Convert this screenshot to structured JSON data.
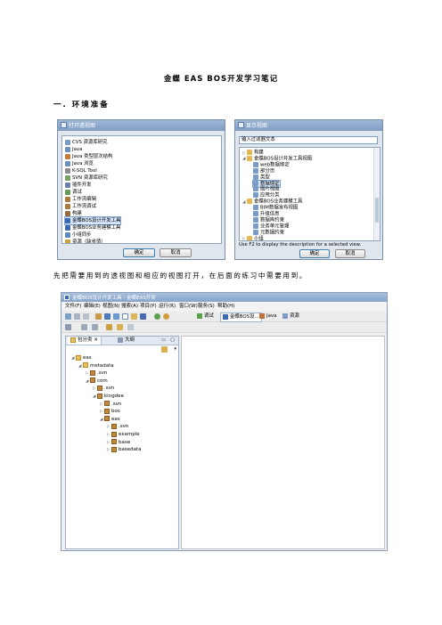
{
  "doc": {
    "title": "金蝶 EAS BOS开发学习笔记",
    "section": "一.  环境准备",
    "paragraph": "先把需要用到的透视图和相应的视图打开，在后面的练习中需要用到。"
  },
  "dialog_left": {
    "title": "打开透视图",
    "items": [
      {
        "label": "CVS 资源库研究",
        "color": "#7a9cc6"
      },
      {
        "label": "Java",
        "color": "#6d8fc0"
      },
      {
        "label": "Java 类型层次结构",
        "color": "#c77a3a"
      },
      {
        "label": "Java 浏览",
        "color": "#6d8fc0"
      },
      {
        "label": "K-SQL Tool",
        "color": "#8a8a8a"
      },
      {
        "label": "SVN 资源库研究",
        "color": "#7aa06a"
      },
      {
        "label": "插件开发",
        "color": "#6a7fb0"
      },
      {
        "label": "调试",
        "color": "#6a9a5a"
      },
      {
        "label": "工作流编辑",
        "color": "#b07a3a"
      },
      {
        "label": "工作流调试",
        "color": "#b07a3a"
      },
      {
        "label": "构建",
        "color": "#9a6a3a"
      },
      {
        "label": "金蝶BOS设计开发工具",
        "color": "#3a6ab0",
        "selected": true
      },
      {
        "label": "金蝶BOS业务建模工具",
        "color": "#3a6ab0"
      },
      {
        "label": "小组同步",
        "color": "#5a8aba"
      },
      {
        "label": "资源（缺省值）",
        "color": "#d0a040"
      }
    ],
    "ok": "确定",
    "cancel": "取消"
  },
  "dialog_right": {
    "title": "显示视图",
    "filter_placeholder": "输入过滤器文本",
    "tree": [
      {
        "label": "构建",
        "level": 0,
        "kind": "folder",
        "twisty": "▷"
      },
      {
        "label": "金蝶BOS设计开发工具视图",
        "level": 0,
        "kind": "folder",
        "twisty": "◢"
      },
      {
        "label": "web数据绑定",
        "level": 1,
        "kind": "view"
      },
      {
        "label": "部分页",
        "level": 1,
        "kind": "view"
      },
      {
        "label": "类型",
        "level": 1,
        "kind": "view"
      },
      {
        "label": "数据绑定",
        "level": 1,
        "kind": "view",
        "selected": true
      },
      {
        "label": "图片视图",
        "level": 1,
        "kind": "view"
      },
      {
        "label": "应用分类",
        "level": 1,
        "kind": "view"
      },
      {
        "label": "金蝶BOS业务建模工具",
        "level": 0,
        "kind": "folder",
        "twisty": "◢"
      },
      {
        "label": "BIM数据发布视图",
        "level": 1,
        "kind": "view"
      },
      {
        "label": "升级信息",
        "level": 1,
        "kind": "view"
      },
      {
        "label": "数据库约束",
        "level": 1,
        "kind": "view"
      },
      {
        "label": "业务单元管理",
        "level": 1,
        "kind": "view"
      },
      {
        "label": "元数据约束",
        "level": 1,
        "kind": "view"
      },
      {
        "label": "小组",
        "level": 0,
        "kind": "folder",
        "twisty": "▷"
      }
    ],
    "hint": "Use F2 to display the description for a selected view.",
    "ok": "确定",
    "cancel": "取消"
  },
  "ide": {
    "title": "金蝶BOS设计开发工具 - 金蝶EAS开发",
    "menu": [
      "文件(F)",
      "编辑(E)",
      "视图(N)",
      "搜索(A)",
      "项目(P)",
      "运行(R)",
      "窗口(W)",
      "服务(S)",
      "帮助(H)"
    ],
    "perspectives": [
      "调试",
      "金蝶BOS设...",
      "Java",
      "资源"
    ],
    "tabs": [
      "包分类",
      "大纲"
    ],
    "tree": [
      {
        "label": "eas",
        "level": 0,
        "kind": "project",
        "twisty": "◢"
      },
      {
        "label": "metadata",
        "level": 1,
        "kind": "folder",
        "twisty": "◢"
      },
      {
        "label": ".svn",
        "level": 2,
        "kind": "pkg",
        "twisty": "▷"
      },
      {
        "label": "com",
        "level": 2,
        "kind": "pkg",
        "twisty": "◢"
      },
      {
        "label": ".svn",
        "level": 3,
        "kind": "pkg",
        "twisty": "▷"
      },
      {
        "label": "kingdee",
        "level": 3,
        "kind": "pkg",
        "twisty": "◢"
      },
      {
        "label": ".svn",
        "level": 4,
        "kind": "pkg",
        "twisty": "▷"
      },
      {
        "label": "bos",
        "level": 4,
        "kind": "pkg",
        "twisty": "▷"
      },
      {
        "label": "eas",
        "level": 4,
        "kind": "pkg",
        "twisty": "◢"
      },
      {
        "label": ".svn",
        "level": 5,
        "kind": "pkg",
        "twisty": "▷"
      },
      {
        "label": "example",
        "level": 5,
        "kind": "pkg",
        "twisty": "▷"
      },
      {
        "label": "base",
        "level": 5,
        "kind": "pkg",
        "twisty": "▷"
      },
      {
        "label": "basedata",
        "level": 5,
        "kind": "pkg",
        "twisty": "▷"
      }
    ]
  }
}
